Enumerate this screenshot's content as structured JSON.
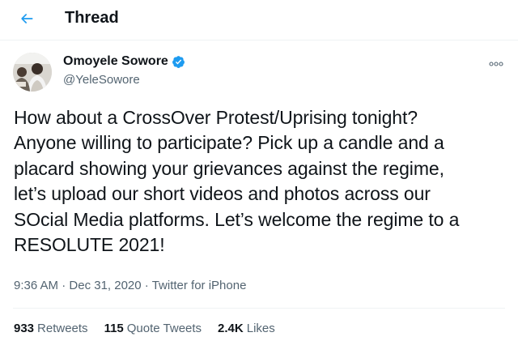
{
  "header": {
    "back_icon": "arrow-left-icon",
    "title": "Thread"
  },
  "accent_color": "#1d9bf0",
  "author": {
    "display_name": "Omoyele Sowore",
    "handle": "@YeleSowore",
    "verified_icon": "verified-badge-icon",
    "more_icon": "more-options-icon"
  },
  "tweet": {
    "text": "How about a CrossOver Protest/Uprising tonight?\nAnyone willing to participate? Pick up a candle and a\nplacard showing your grievances against the regime,\nlet’s upload our short videos and photos across our\nSOcial Media platforms. Let’s welcome the regime to a\nRESOLUTE 2021!",
    "time": "9:36 AM",
    "date": "Dec 31, 2020",
    "source": "Twitter for iPhone",
    "separator": "·"
  },
  "stats": [
    {
      "count": "933",
      "label": "Retweets"
    },
    {
      "count": "115",
      "label": "Quote Tweets"
    },
    {
      "count": "2.4K",
      "label": "Likes"
    }
  ]
}
